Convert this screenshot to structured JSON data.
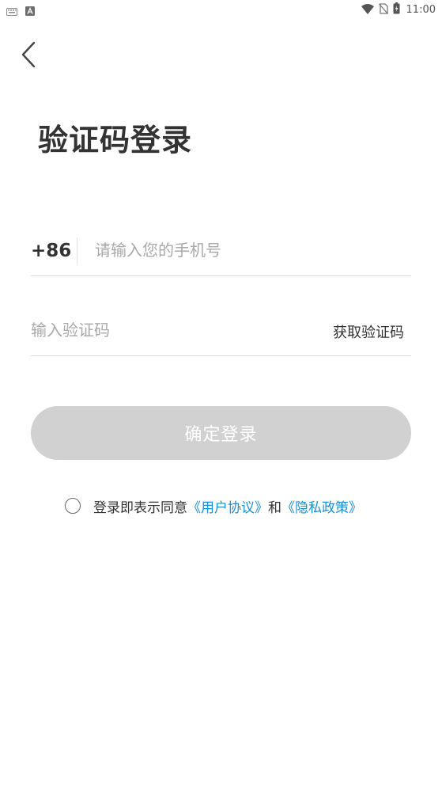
{
  "status_bar": {
    "time": "11:00",
    "left_icons": [
      "keyboard-icon",
      "a-app-icon"
    ],
    "right_icons": [
      "wifi-icon",
      "no-sim-icon",
      "battery-icon"
    ]
  },
  "header": {
    "back_icon": "chevron-left-icon"
  },
  "title": "验证码登录",
  "phone": {
    "country_code": "+86",
    "placeholder": "请输入您的手机号"
  },
  "code": {
    "placeholder": "输入验证码",
    "get_code_label": "获取验证码"
  },
  "submit": {
    "label": "确定登录",
    "disabled": true
  },
  "agreement": {
    "checked": false,
    "prefix": "登录即表示同意",
    "user_agreement": "《用户协议》",
    "conjunction": "和",
    "privacy_policy": "《隐私政策》"
  },
  "colors": {
    "accent_link": "#1a8fd6",
    "button_disabled": "#d1d1d1",
    "text_primary": "#333333",
    "placeholder": "#a9a9a9",
    "divider": "#dddddd"
  }
}
